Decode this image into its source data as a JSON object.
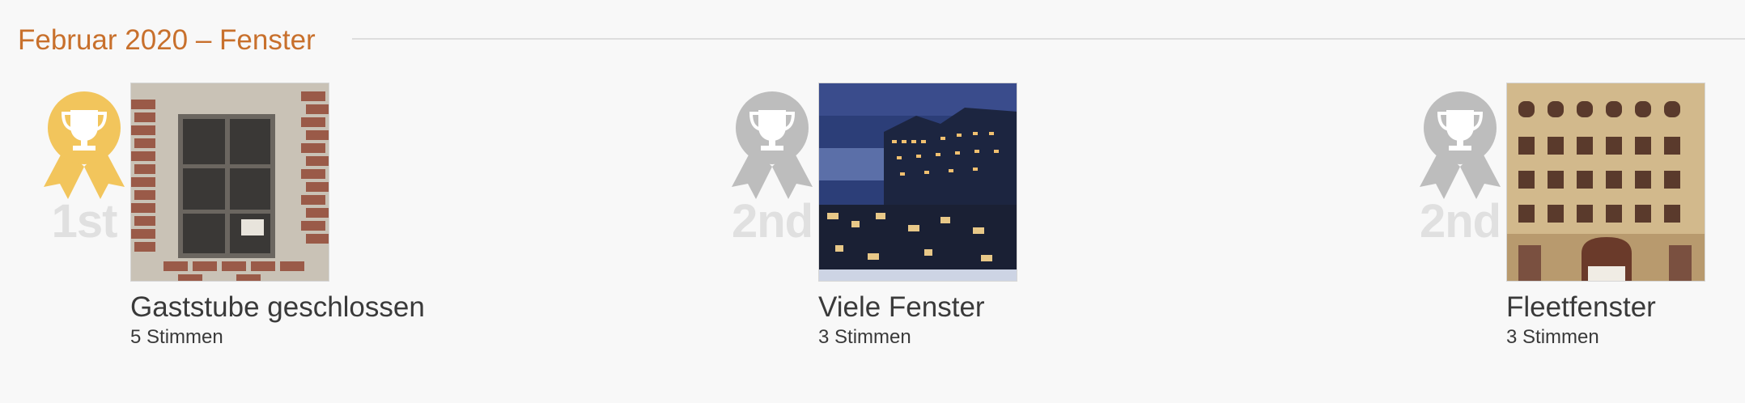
{
  "section": {
    "title": "Februar 2020 – Fenster"
  },
  "entries": [
    {
      "rank": "1st",
      "medal": "gold-trophy-icon",
      "medal_color": "#f2c55c",
      "title": "Gaststube geschlossen",
      "votes": "5 Stimmen",
      "image": "old-window-photo"
    },
    {
      "rank": "2nd",
      "medal": "silver-trophy-icon",
      "medal_color": "#bdbdbd",
      "title": "Viele Fenster",
      "votes": "3 Stimmen",
      "image": "elbphilharmonie-night-photo"
    },
    {
      "rank": "2nd",
      "medal": "silver-trophy-icon",
      "medal_color": "#bdbdbd",
      "title": "Fleetfenster",
      "votes": "3 Stimmen",
      "image": "brick-facade-windows-photo"
    }
  ],
  "colors": {
    "accent": "#c8702c",
    "gold": "#f2c55c",
    "silver": "#bdbdbd",
    "rank_text": "#e0e0e0"
  }
}
